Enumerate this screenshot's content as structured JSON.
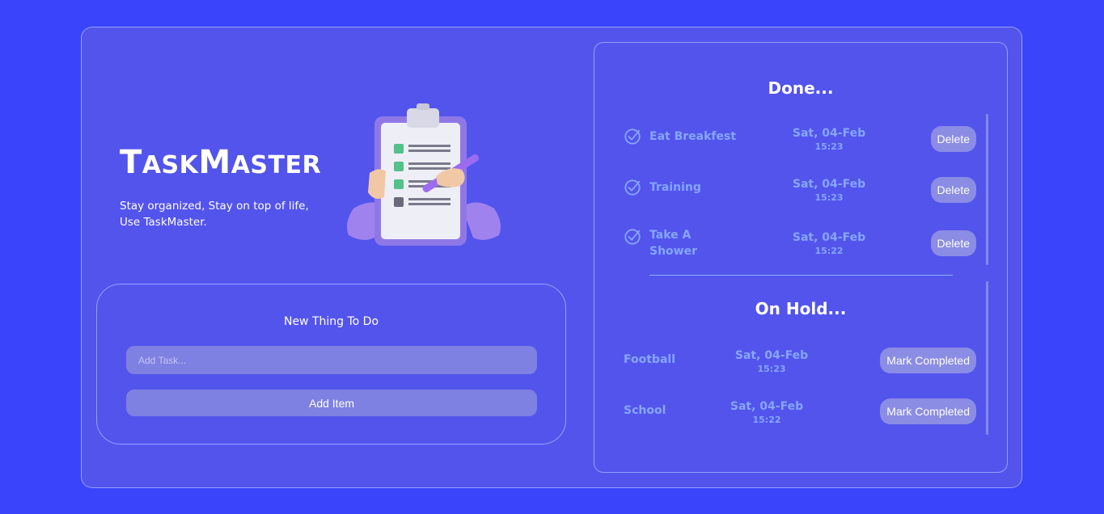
{
  "hero": {
    "brand_first_letter_1": "T",
    "brand_rest_1": "ASK",
    "brand_first_letter_2": "M",
    "brand_rest_2": "ASTER",
    "tagline_line1": "Stay organized, Stay on top of life,",
    "tagline_line2": "Use TaskMaster."
  },
  "form": {
    "title": "New Thing To Do",
    "placeholder": "Add Task...",
    "add_label": "Add Item"
  },
  "done": {
    "title": "Done...",
    "items": [
      {
        "name": "Eat Breakfest",
        "date": "Sat, 04-Feb",
        "time": "15:23",
        "action": "Delete"
      },
      {
        "name": "Training",
        "date": "Sat, 04-Feb",
        "time": "15:23",
        "action": "Delete"
      },
      {
        "name_line1": "Take A",
        "name_line2": "Shower",
        "date": "Sat, 04-Feb",
        "time": "15:22",
        "action": "Delete"
      }
    ]
  },
  "on_hold": {
    "title": "On Hold...",
    "items": [
      {
        "name": "Football",
        "date": "Sat, 04-Feb",
        "time": "15:23",
        "action": "Mark Completed"
      },
      {
        "name": "School",
        "date": "Sat, 04-Feb",
        "time": "15:22",
        "action": "Mark Completed"
      }
    ]
  },
  "colors": {
    "page_bg": "#3a44fb",
    "card_bg": "#5354ec",
    "button_bg": "#8b8ce4",
    "accent_text": "#86a6ff"
  }
}
